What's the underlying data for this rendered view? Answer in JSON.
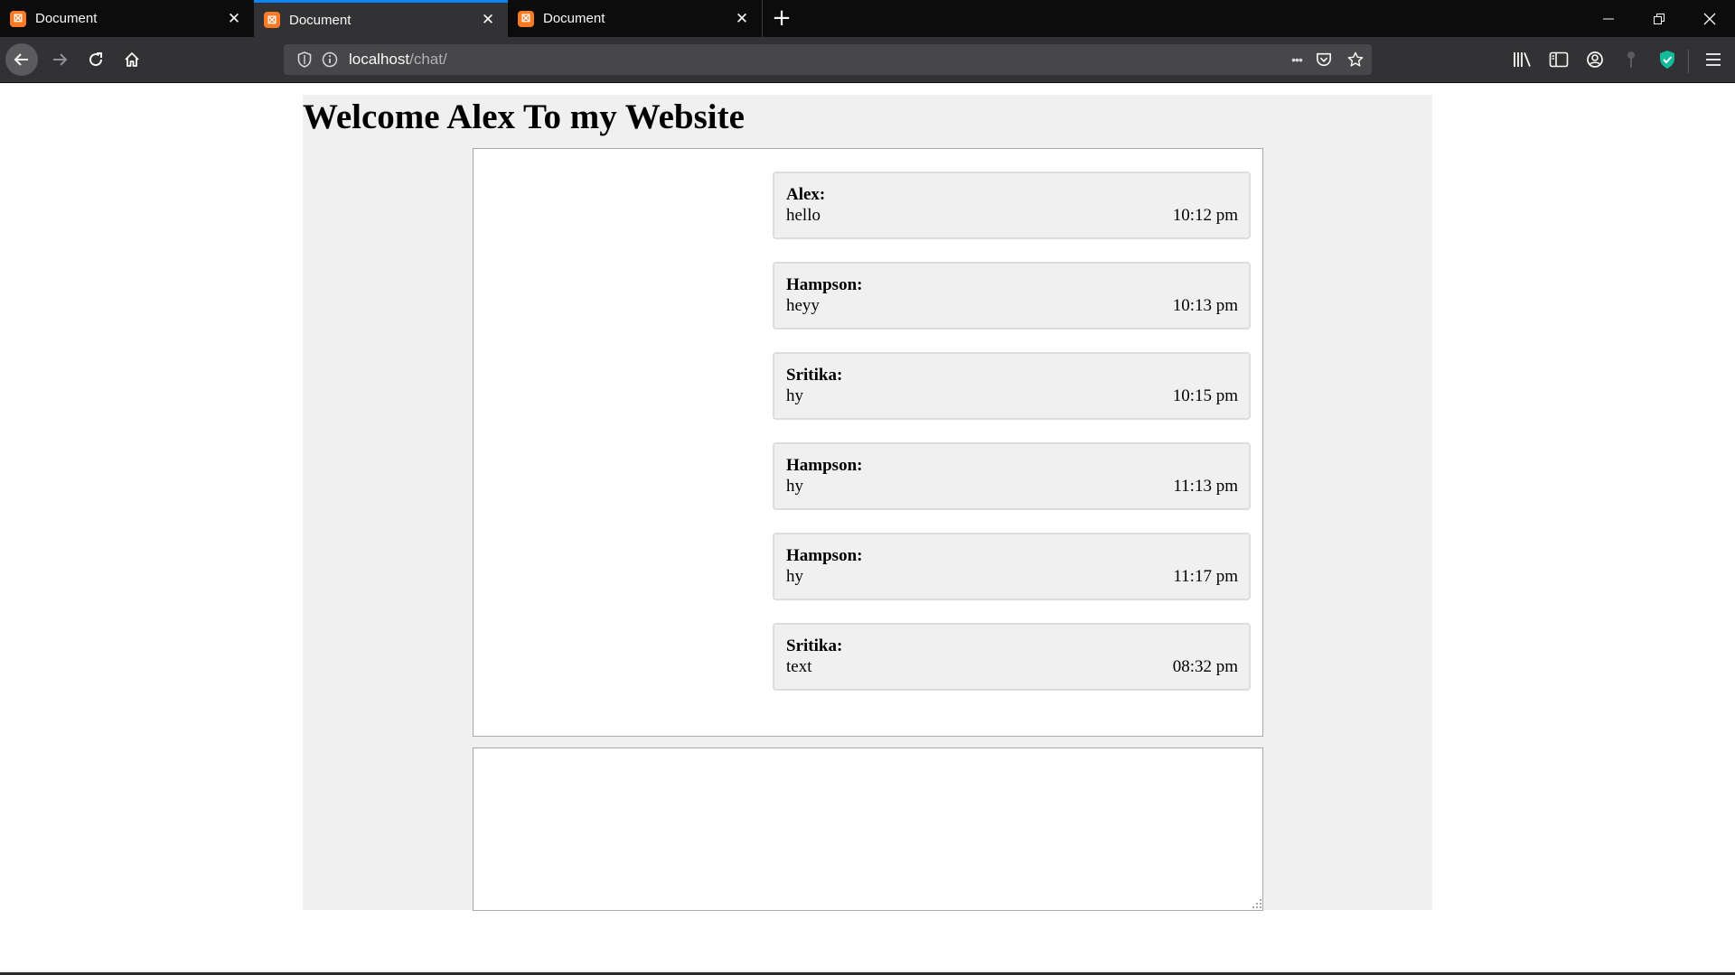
{
  "browser": {
    "tabs": [
      {
        "title": "Document",
        "active": false
      },
      {
        "title": "Document",
        "active": true
      },
      {
        "title": "Document",
        "active": false
      }
    ],
    "favicon_glyph": "⊠",
    "close_glyph": "✕",
    "new_tab_glyph": "+",
    "url_host": "localhost",
    "url_path": "/chat/",
    "more_glyph": "•••",
    "colors": {
      "accent": "#0a84ff",
      "tab_bg": "#0c0c0d",
      "toolbar_bg": "#323234",
      "favicon": "#fb7a24",
      "shield": "#12bc9a"
    }
  },
  "page": {
    "title": "Welcome Alex To my Website",
    "messages": [
      {
        "sender": "Alex:",
        "text": "hello",
        "time": "10:12 pm"
      },
      {
        "sender": "Hampson:",
        "text": "heyy",
        "time": "10:13 pm"
      },
      {
        "sender": "Sritika:",
        "text": "hy",
        "time": "10:15 pm"
      },
      {
        "sender": "Hampson:",
        "text": "hy",
        "time": "11:13 pm"
      },
      {
        "sender": "Hampson:",
        "text": "hy",
        "time": "11:17 pm"
      },
      {
        "sender": "Sritika:",
        "text": "text",
        "time": "08:32 pm"
      }
    ],
    "input_value": ""
  }
}
